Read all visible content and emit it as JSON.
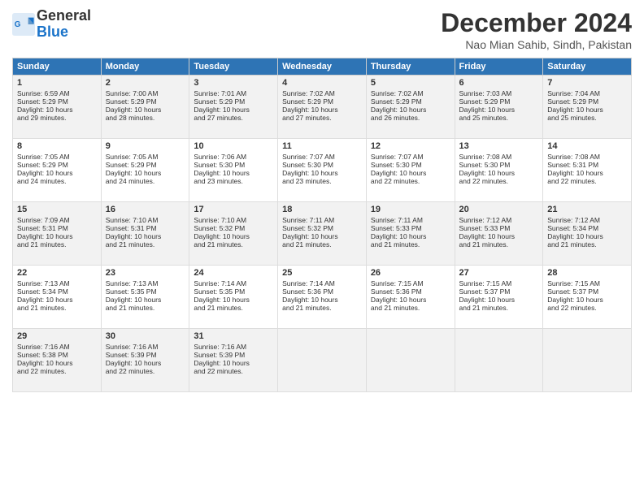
{
  "logo": {
    "line1": "General",
    "line2": "Blue"
  },
  "title": "December 2024",
  "subtitle": "Nao Mian Sahib, Sindh, Pakistan",
  "headers": [
    "Sunday",
    "Monday",
    "Tuesday",
    "Wednesday",
    "Thursday",
    "Friday",
    "Saturday"
  ],
  "weeks": [
    [
      {
        "day": "1",
        "lines": [
          "Sunrise: 6:59 AM",
          "Sunset: 5:29 PM",
          "Daylight: 10 hours",
          "and 29 minutes."
        ]
      },
      {
        "day": "2",
        "lines": [
          "Sunrise: 7:00 AM",
          "Sunset: 5:29 PM",
          "Daylight: 10 hours",
          "and 28 minutes."
        ]
      },
      {
        "day": "3",
        "lines": [
          "Sunrise: 7:01 AM",
          "Sunset: 5:29 PM",
          "Daylight: 10 hours",
          "and 27 minutes."
        ]
      },
      {
        "day": "4",
        "lines": [
          "Sunrise: 7:02 AM",
          "Sunset: 5:29 PM",
          "Daylight: 10 hours",
          "and 27 minutes."
        ]
      },
      {
        "day": "5",
        "lines": [
          "Sunrise: 7:02 AM",
          "Sunset: 5:29 PM",
          "Daylight: 10 hours",
          "and 26 minutes."
        ]
      },
      {
        "day": "6",
        "lines": [
          "Sunrise: 7:03 AM",
          "Sunset: 5:29 PM",
          "Daylight: 10 hours",
          "and 25 minutes."
        ]
      },
      {
        "day": "7",
        "lines": [
          "Sunrise: 7:04 AM",
          "Sunset: 5:29 PM",
          "Daylight: 10 hours",
          "and 25 minutes."
        ]
      }
    ],
    [
      {
        "day": "8",
        "lines": [
          "Sunrise: 7:05 AM",
          "Sunset: 5:29 PM",
          "Daylight: 10 hours",
          "and 24 minutes."
        ]
      },
      {
        "day": "9",
        "lines": [
          "Sunrise: 7:05 AM",
          "Sunset: 5:29 PM",
          "Daylight: 10 hours",
          "and 24 minutes."
        ]
      },
      {
        "day": "10",
        "lines": [
          "Sunrise: 7:06 AM",
          "Sunset: 5:30 PM",
          "Daylight: 10 hours",
          "and 23 minutes."
        ]
      },
      {
        "day": "11",
        "lines": [
          "Sunrise: 7:07 AM",
          "Sunset: 5:30 PM",
          "Daylight: 10 hours",
          "and 23 minutes."
        ]
      },
      {
        "day": "12",
        "lines": [
          "Sunrise: 7:07 AM",
          "Sunset: 5:30 PM",
          "Daylight: 10 hours",
          "and 22 minutes."
        ]
      },
      {
        "day": "13",
        "lines": [
          "Sunrise: 7:08 AM",
          "Sunset: 5:30 PM",
          "Daylight: 10 hours",
          "and 22 minutes."
        ]
      },
      {
        "day": "14",
        "lines": [
          "Sunrise: 7:08 AM",
          "Sunset: 5:31 PM",
          "Daylight: 10 hours",
          "and 22 minutes."
        ]
      }
    ],
    [
      {
        "day": "15",
        "lines": [
          "Sunrise: 7:09 AM",
          "Sunset: 5:31 PM",
          "Daylight: 10 hours",
          "and 21 minutes."
        ]
      },
      {
        "day": "16",
        "lines": [
          "Sunrise: 7:10 AM",
          "Sunset: 5:31 PM",
          "Daylight: 10 hours",
          "and 21 minutes."
        ]
      },
      {
        "day": "17",
        "lines": [
          "Sunrise: 7:10 AM",
          "Sunset: 5:32 PM",
          "Daylight: 10 hours",
          "and 21 minutes."
        ]
      },
      {
        "day": "18",
        "lines": [
          "Sunrise: 7:11 AM",
          "Sunset: 5:32 PM",
          "Daylight: 10 hours",
          "and 21 minutes."
        ]
      },
      {
        "day": "19",
        "lines": [
          "Sunrise: 7:11 AM",
          "Sunset: 5:33 PM",
          "Daylight: 10 hours",
          "and 21 minutes."
        ]
      },
      {
        "day": "20",
        "lines": [
          "Sunrise: 7:12 AM",
          "Sunset: 5:33 PM",
          "Daylight: 10 hours",
          "and 21 minutes."
        ]
      },
      {
        "day": "21",
        "lines": [
          "Sunrise: 7:12 AM",
          "Sunset: 5:34 PM",
          "Daylight: 10 hours",
          "and 21 minutes."
        ]
      }
    ],
    [
      {
        "day": "22",
        "lines": [
          "Sunrise: 7:13 AM",
          "Sunset: 5:34 PM",
          "Daylight: 10 hours",
          "and 21 minutes."
        ]
      },
      {
        "day": "23",
        "lines": [
          "Sunrise: 7:13 AM",
          "Sunset: 5:35 PM",
          "Daylight: 10 hours",
          "and 21 minutes."
        ]
      },
      {
        "day": "24",
        "lines": [
          "Sunrise: 7:14 AM",
          "Sunset: 5:35 PM",
          "Daylight: 10 hours",
          "and 21 minutes."
        ]
      },
      {
        "day": "25",
        "lines": [
          "Sunrise: 7:14 AM",
          "Sunset: 5:36 PM",
          "Daylight: 10 hours",
          "and 21 minutes."
        ]
      },
      {
        "day": "26",
        "lines": [
          "Sunrise: 7:15 AM",
          "Sunset: 5:36 PM",
          "Daylight: 10 hours",
          "and 21 minutes."
        ]
      },
      {
        "day": "27",
        "lines": [
          "Sunrise: 7:15 AM",
          "Sunset: 5:37 PM",
          "Daylight: 10 hours",
          "and 21 minutes."
        ]
      },
      {
        "day": "28",
        "lines": [
          "Sunrise: 7:15 AM",
          "Sunset: 5:37 PM",
          "Daylight: 10 hours",
          "and 22 minutes."
        ]
      }
    ],
    [
      {
        "day": "29",
        "lines": [
          "Sunrise: 7:16 AM",
          "Sunset: 5:38 PM",
          "Daylight: 10 hours",
          "and 22 minutes."
        ]
      },
      {
        "day": "30",
        "lines": [
          "Sunrise: 7:16 AM",
          "Sunset: 5:39 PM",
          "Daylight: 10 hours",
          "and 22 minutes."
        ]
      },
      {
        "day": "31",
        "lines": [
          "Sunrise: 7:16 AM",
          "Sunset: 5:39 PM",
          "Daylight: 10 hours",
          "and 22 minutes."
        ]
      },
      null,
      null,
      null,
      null
    ]
  ]
}
